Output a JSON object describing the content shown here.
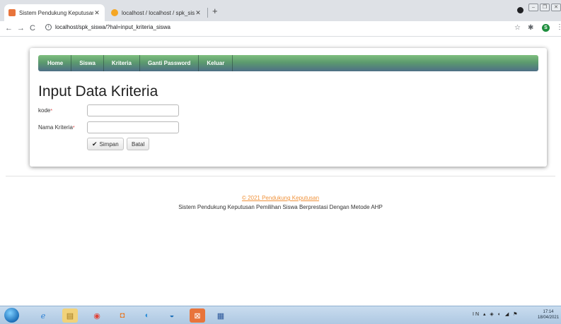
{
  "browser": {
    "tabs": [
      {
        "title": "Sistem Pendukung Keputusan Pe",
        "active": true,
        "icon": "spk-favicon-icon",
        "color": "#e8743b"
      },
      {
        "title": "localhost / localhost / spk_siswa",
        "active": false,
        "icon": "phpmyadmin-favicon-icon",
        "color": "#f5a623"
      }
    ],
    "url": "localhost/spk_siswa/?hal=input_kriteria_siswa",
    "profile_initial": "S"
  },
  "nav": {
    "items": [
      "Home",
      "Siswa",
      "Kriteria",
      "Ganti Password",
      "Keluar"
    ],
    "gradient_top": "#7fbf7f",
    "gradient_bottom": "#4e6f86"
  },
  "form": {
    "title": "Input Data Kriteria",
    "fields": [
      {
        "label": "kode",
        "required_mark": "*",
        "value": ""
      },
      {
        "label": "Nama Kriteria",
        "required_mark": "*",
        "value": ""
      }
    ],
    "buttons": {
      "save_label": "Simpan",
      "cancel_label": "Batal"
    }
  },
  "footer": {
    "copyright": "© 2021 Pendukung Keputusan",
    "tagline": "Sistem Pendukung Keputusan Pemilihan Siswa Berprestasi Dengan Metode AHP",
    "link_color": "#f0923a"
  },
  "taskbar": {
    "clock_time": "17:14",
    "clock_date": "18/04/2021",
    "tray_lang": "IN"
  }
}
